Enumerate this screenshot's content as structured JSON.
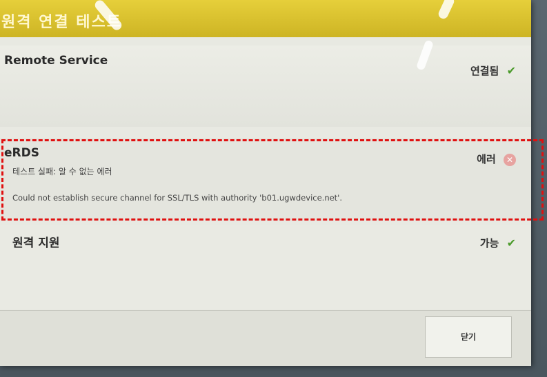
{
  "dialog": {
    "title": "원격 연결 테스트"
  },
  "sections": {
    "remote_service": {
      "title": "Remote Service",
      "status": "연결됨",
      "status_icon": "check-icon"
    },
    "erds": {
      "title": "eRDS",
      "status": "에러",
      "status_icon": "error-icon",
      "line1": "테스트 실패: 알 수 없는 에러",
      "line2": "Could not establish secure channel for SSL/TLS with authority 'b01.ugwdevice.net'."
    },
    "remote_support": {
      "title": "원격 지원",
      "status": "가능",
      "status_icon": "check-icon"
    }
  },
  "footer": {
    "close_label": "닫기"
  },
  "colors": {
    "title_bar": "#d9c12f",
    "highlight_dash": "#e01010",
    "ok_check": "#4a9a2a",
    "error_icon": "#e7a3a0"
  }
}
